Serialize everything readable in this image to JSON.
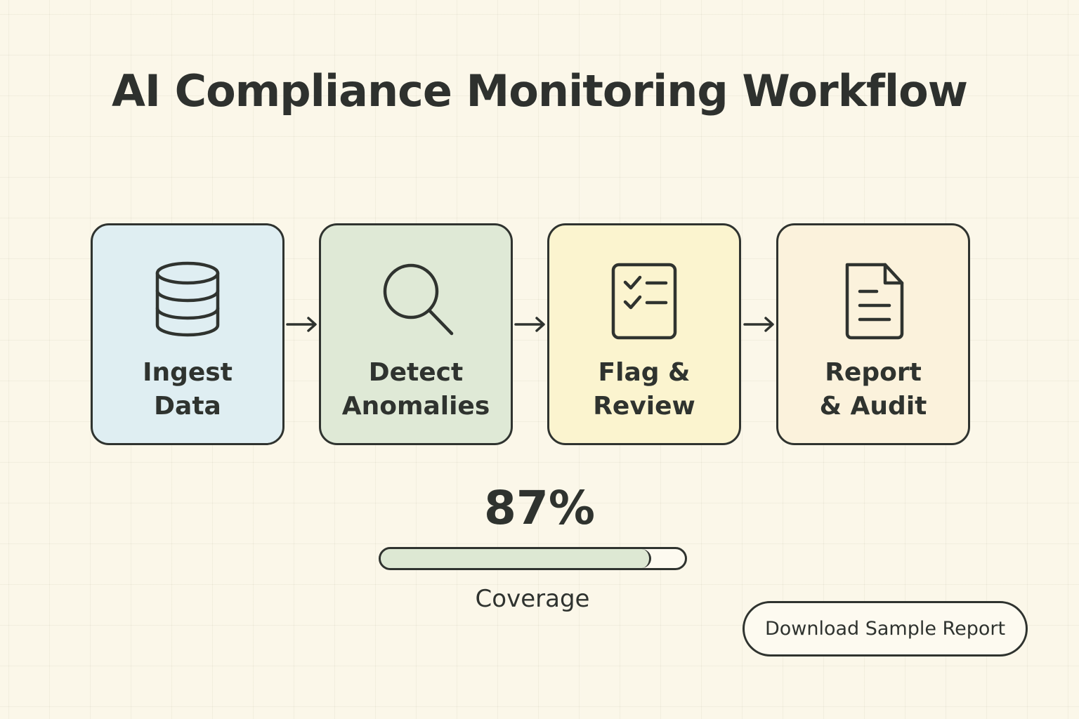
{
  "title": "AI Compliance Monitoring Workflow",
  "steps": [
    {
      "line1": "Ingest",
      "line2": "Data",
      "icon": "database-icon",
      "color": "#dfeef2"
    },
    {
      "line1": "Detect",
      "line2": "Anomalies",
      "icon": "magnifier-icon",
      "color": "#dfe9d6"
    },
    {
      "line1": "Flag &",
      "line2": "Review",
      "icon": "checklist-icon",
      "color": "#fbf4cf"
    },
    {
      "line1": "Report",
      "line2": "& Audit",
      "icon": "document-icon",
      "color": "#fbf2dc"
    }
  ],
  "coverage": {
    "percent_text": "87%",
    "value": 0.89,
    "label": "Coverage",
    "fill_color": "#dde8d3"
  },
  "download_button": {
    "label": "Download Sample Report"
  },
  "colors": {
    "background": "#fbf7e9",
    "stroke": "#2f332f"
  }
}
